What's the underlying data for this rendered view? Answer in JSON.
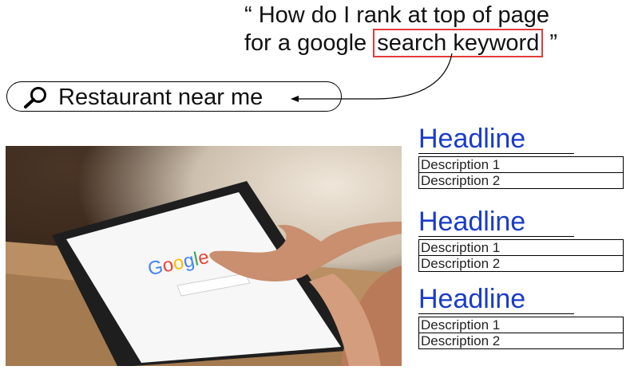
{
  "quote": {
    "open": "“ How do I rank at top of page",
    "line2_prefix": "for a google ",
    "keyword": "search keyword",
    "close": " ”"
  },
  "search": {
    "icon": "magnifier-icon",
    "text": "Restaurant near me"
  },
  "photo": {
    "screen_logo": "Google"
  },
  "ads": [
    {
      "headline": "Headline",
      "desc1": "Description 1",
      "desc2": "Description 2"
    },
    {
      "headline": "Headline",
      "desc1": "Description 1",
      "desc2": "Description 2"
    },
    {
      "headline": "Headline",
      "desc1": "Description 1",
      "desc2": "Description 2"
    }
  ],
  "colors": {
    "headline": "#1a3cc8",
    "keyword_box": "#e23b3b",
    "google_blue": "#4285f4",
    "google_red": "#ea4335",
    "google_yellow": "#fbbc05",
    "google_green": "#34a853"
  }
}
